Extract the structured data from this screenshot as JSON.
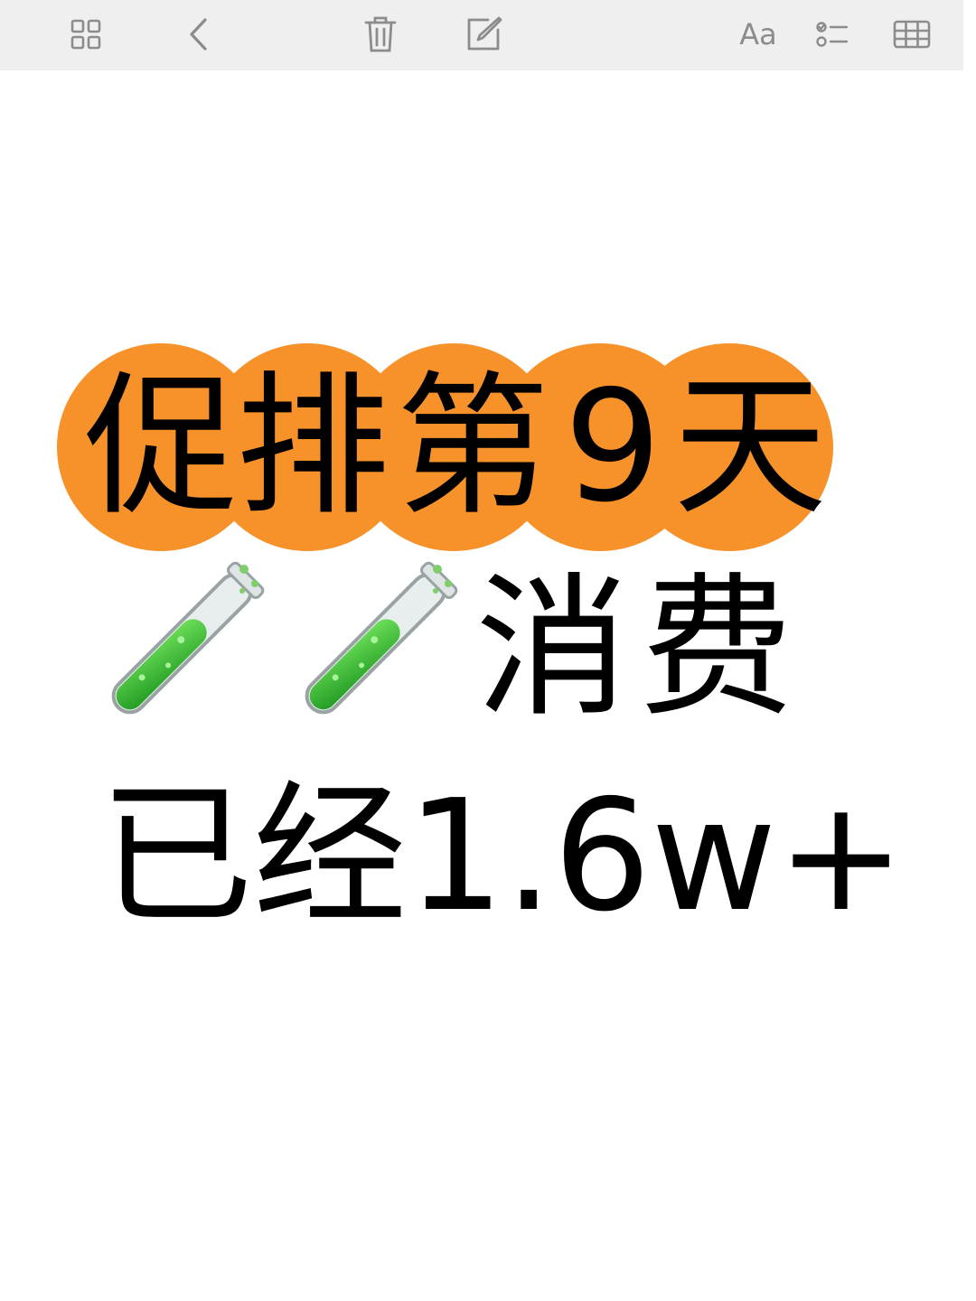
{
  "toolbar": {
    "icons": [
      "grid-icon",
      "back-chevron-icon",
      "trash-icon",
      "edit-icon",
      "text-format-icon",
      "checklist-icon",
      "table-icon"
    ],
    "text_format_label": "Aa"
  },
  "note": {
    "title_chars": [
      "促",
      "排",
      "第",
      "9",
      "天"
    ],
    "title_bg_color": "#f7922b",
    "emoji_label": "🧪🧪",
    "line2_text": "消费",
    "line3_text": "已经1.6w+"
  }
}
